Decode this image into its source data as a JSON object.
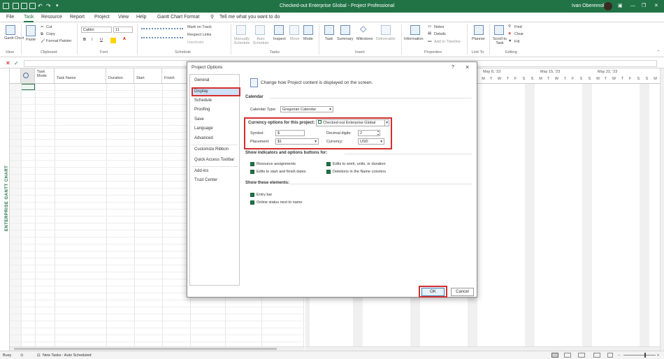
{
  "titlebar": {
    "title": "Checked-out Enterprise Global  -  Project Professional",
    "user": "Ivan Oberemok",
    "bg": "#217346"
  },
  "menu": [
    "File",
    "Task",
    "Resource",
    "Report",
    "Project",
    "View",
    "Help",
    "Gantt Chart Format",
    "Tell me what you want to do"
  ],
  "ribbon": {
    "view_group": "View",
    "gantt_chart": "Gantt Chart",
    "paste": "Paste",
    "cut": "Cut",
    "copy": "Copy",
    "format_painter": "Format Painter",
    "clipboard": "Clipboard",
    "font_name": "Calibri",
    "font_size": "11",
    "font": "Font",
    "mark_on_track": "Mark on Track",
    "respect_links": "Respect Links",
    "inactivate": "Inactivate",
    "schedule": "Schedule",
    "manually": "Manually Schedule",
    "auto": "Auto Schedule",
    "inspect": "Inspect",
    "move": "Move",
    "mode": "Mode",
    "tasks": "Tasks",
    "task": "Task",
    "summary": "Summary",
    "milestone": "Milestone",
    "deliverable": "Deliverable",
    "insert": "Insert",
    "information": "Information",
    "notes": "Notes",
    "details": "Details",
    "add_timeline": "Add to Timeline",
    "properties": "Properties",
    "planner": "Planner",
    "link_to": "Link To",
    "scroll": "Scroll to Task",
    "find": "Find",
    "clear": "Clear",
    "fill": "Fill",
    "editing": "Editing"
  },
  "grid": {
    "headers": [
      "Task Mode",
      "Task Name",
      "Duration",
      "Start",
      "Finish"
    ]
  },
  "gantt": {
    "weeks": [
      "May 8, '23",
      "May 15, '23",
      "May 22, '23"
    ],
    "days": [
      "M",
      "T",
      "W",
      "T",
      "F",
      "S",
      "S",
      "M",
      "T",
      "W",
      "T",
      "F",
      "S",
      "S",
      "M",
      "T",
      "W",
      "T",
      "F",
      "S",
      "S",
      "M",
      "T",
      "W",
      "T",
      "F",
      "S",
      "S"
    ]
  },
  "sidebar_label": "ENTERPRISE GANTT CHART",
  "status": {
    "ready": "Busy",
    "new_tasks": "New Tasks : Auto Scheduled"
  },
  "dialog": {
    "title": "Project Options",
    "help": "?",
    "close": "×",
    "nav": [
      "General",
      "Display",
      "Schedule",
      "Proofing",
      "Save",
      "Language",
      "Advanced",
      "Customize Ribbon",
      "Quick Access Toolbar",
      "Add-ins",
      "Trust Center"
    ],
    "selected": "Display",
    "intro": "Change how Project content is displayed on the screen.",
    "calendar_header": "Calendar",
    "calendar_type_label": "Calendar Type:",
    "calendar_type_value": "Gregorian Calendar",
    "currency_label": "Currency options for this project:",
    "currency_project": "Checked-out Enterprise Global",
    "symbol_label": "Symbol:",
    "symbol_value": "$",
    "decimal_label": "Decimal digits:",
    "decimal_value": "2",
    "placement_label": "Placement:",
    "placement_value": "$1",
    "currency_code_label": "Currency:",
    "currency_code_value": "USD",
    "indicators_header": "Show indicators and options buttons for:",
    "opt_resource": "Resource assignments",
    "opt_edits_work": "Edits to work, units, or duration",
    "opt_edits_dates": "Edits to start and finish dates",
    "opt_deletions": "Deletions in the Name columns",
    "elements_header": "Show these elements:",
    "opt_entry_bar": "Entry bar",
    "opt_online_status": "Online status next to name",
    "ok": "OK",
    "cancel": "Cancel"
  }
}
